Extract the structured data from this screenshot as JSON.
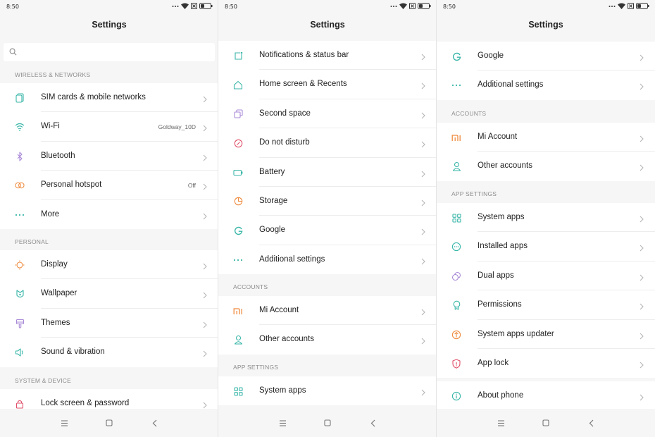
{
  "status": {
    "time": "8:50"
  },
  "title": "Settings",
  "search": {
    "placeholder": ""
  },
  "colors": {
    "accent_teal": "#38b6a8",
    "accent_orange": "#ef8a3d",
    "accent_purple": "#a98ad8",
    "accent_red": "#e0506a"
  },
  "screen1": {
    "sections": [
      {
        "title": "WIRELESS & NETWORKS",
        "items": [
          {
            "label": "SIM cards & mobile networks",
            "value": "",
            "icon": "sim-icon"
          },
          {
            "label": "Wi-Fi",
            "value": "Goldway_10D",
            "icon": "wifi-icon"
          },
          {
            "label": "Bluetooth",
            "value": "",
            "icon": "bluetooth-icon"
          },
          {
            "label": "Personal hotspot",
            "value": "Off",
            "icon": "hotspot-icon"
          },
          {
            "label": "More",
            "value": "",
            "icon": "more-icon"
          }
        ]
      },
      {
        "title": "PERSONAL",
        "items": [
          {
            "label": "Display",
            "value": "",
            "icon": "display-icon"
          },
          {
            "label": "Wallpaper",
            "value": "",
            "icon": "wallpaper-icon"
          },
          {
            "label": "Themes",
            "value": "",
            "icon": "themes-icon"
          },
          {
            "label": "Sound & vibration",
            "value": "",
            "icon": "sound-icon"
          }
        ]
      },
      {
        "title": "SYSTEM & DEVICE",
        "items": [
          {
            "label": "Lock screen & password",
            "value": "",
            "icon": "lock-icon"
          }
        ]
      }
    ]
  },
  "screen2": {
    "top_items": [
      {
        "label": "Notifications & status bar",
        "icon": "notifications-icon"
      },
      {
        "label": "Home screen & Recents",
        "icon": "home-icon"
      },
      {
        "label": "Second space",
        "icon": "second-space-icon"
      },
      {
        "label": "Do not disturb",
        "icon": "do-not-disturb-icon"
      },
      {
        "label": "Battery",
        "icon": "battery-icon"
      },
      {
        "label": "Storage",
        "icon": "storage-icon"
      },
      {
        "label": "Google",
        "icon": "google-icon"
      },
      {
        "label": "Additional settings",
        "icon": "more-icon"
      }
    ],
    "accounts_title": "ACCOUNTS",
    "accounts": [
      {
        "label": "Mi Account",
        "icon": "mi-icon"
      },
      {
        "label": "Other accounts",
        "icon": "person-icon"
      }
    ],
    "app_settings_title": "APP SETTINGS",
    "app_settings": [
      {
        "label": "System apps",
        "icon": "apps-grid-icon"
      }
    ]
  },
  "screen3": {
    "top_items": [
      {
        "label": "Google",
        "icon": "google-icon"
      },
      {
        "label": "Additional settings",
        "icon": "more-icon"
      }
    ],
    "accounts_title": "ACCOUNTS",
    "accounts": [
      {
        "label": "Mi Account",
        "icon": "mi-icon"
      },
      {
        "label": "Other accounts",
        "icon": "person-icon"
      }
    ],
    "app_settings_title": "APP SETTINGS",
    "app_settings": [
      {
        "label": "System apps",
        "icon": "apps-grid-icon"
      },
      {
        "label": "Installed apps",
        "icon": "installed-apps-icon"
      },
      {
        "label": "Dual apps",
        "icon": "dual-apps-icon"
      },
      {
        "label": "Permissions",
        "icon": "permissions-icon"
      },
      {
        "label": "System apps updater",
        "icon": "updater-icon"
      },
      {
        "label": "App lock",
        "icon": "app-lock-icon"
      }
    ],
    "about": [
      {
        "label": "About phone",
        "icon": "info-icon"
      }
    ]
  }
}
